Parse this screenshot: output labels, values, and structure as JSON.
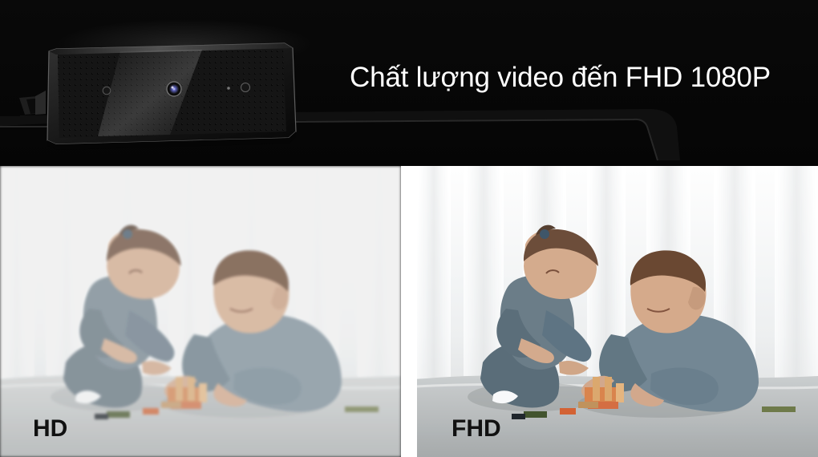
{
  "banner": {
    "headline": "Chất lượng video đến FHD 1080P"
  },
  "comparison": {
    "left_label": "HD",
    "right_label": "FHD"
  },
  "icons": {
    "webcam": "webcam-device-icon",
    "camera_lens": "camera-lens-icon"
  },
  "colors": {
    "banner_background": "#050505",
    "headline_text": "#ffffff",
    "label_text": "#111111",
    "divider": "#ffffff"
  }
}
